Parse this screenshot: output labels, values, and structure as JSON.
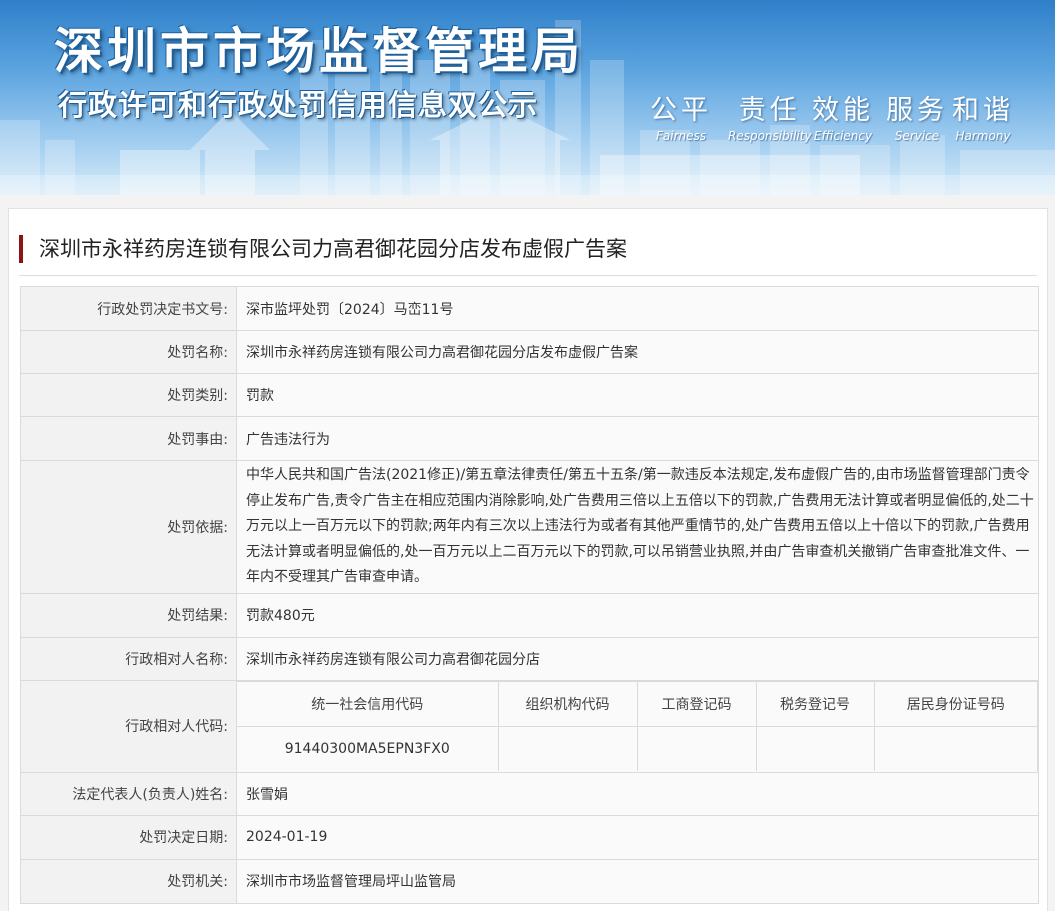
{
  "banner": {
    "title": "深圳市市场监督管理局",
    "subtitle": "行政许可和行政处罚信用信息双公示",
    "values": [
      {
        "zh": "公平",
        "en": "Fairness"
      },
      {
        "zh": "责任",
        "en": "Responsibility"
      },
      {
        "zh": "效能",
        "en": "Efficiency"
      },
      {
        "zh": "服务",
        "en": "Service"
      },
      {
        "zh": "和谐",
        "en": "Harmony"
      }
    ]
  },
  "case_title": "深圳市永祥药房连锁有限公司力高君御花园分店发布虚假广告案",
  "rows": {
    "doc_no": {
      "label": "行政处罚决定书文号:",
      "value": "深市监坪处罚〔2024〕马峦11号"
    },
    "name": {
      "label": "处罚名称:",
      "value": "深圳市永祥药房连锁有限公司力高君御花园分店发布虚假广告案"
    },
    "category": {
      "label": "处罚类别:",
      "value": "罚款"
    },
    "reason": {
      "label": "处罚事由:",
      "value": "广告违法行为"
    },
    "basis": {
      "label": "处罚依据:",
      "value": "中华人民共和国广告法(2021修正)/第五章法律责任/第五十五条/第一款违反本法规定,发布虚假广告的,由市场监督管理部门责令停止发布广告,责令广告主在相应范围内消除影响,处广告费用三倍以上五倍以下的罚款,广告费用无法计算或者明显偏低的,处二十万元以上一百万元以下的罚款;两年内有三次以上违法行为或者有其他严重情节的,处广告费用五倍以上十倍以下的罚款,广告费用无法计算或者明显偏低的,处一百万元以上二百万元以下的罚款,可以吊销营业执照,并由广告审查机关撤销广告审查批准文件、一年内不受理其广告审查申请。"
    },
    "result": {
      "label": "处罚结果:",
      "value": "罚款480元"
    },
    "party": {
      "label": "行政相对人名称:",
      "value": "深圳市永祥药房连锁有限公司力高君御花园分店"
    },
    "codes": {
      "label": "行政相对人代码:",
      "headers": [
        "统一社会信用代码",
        "组织机构代码",
        "工商登记码",
        "税务登记号",
        "居民身份证号码"
      ],
      "values": [
        "91440300MA5EPN3FX0",
        "",
        "",
        "",
        ""
      ]
    },
    "legal_rep": {
      "label": "法定代表人(负责人)姓名:",
      "value": "张雪娟"
    },
    "date": {
      "label": "处罚决定日期:",
      "value": "2024-01-19"
    },
    "authority": {
      "label": "处罚机关:",
      "value": "深圳市市场监督管理局坪山监管局"
    }
  }
}
